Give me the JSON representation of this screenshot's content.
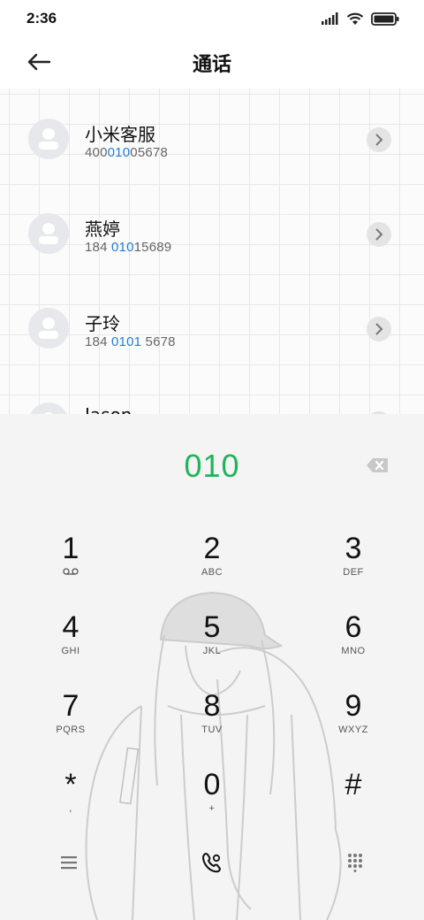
{
  "status_bar": {
    "time": "2:36",
    "icons": [
      "signal-icon",
      "wifi-icon",
      "battery-icon"
    ]
  },
  "header": {
    "title": "通话",
    "back_icon": "back-arrow-icon"
  },
  "contacts": [
    {
      "name": "小米客服",
      "number_pre": "400",
      "number_hl": "010",
      "number_post": "05678"
    },
    {
      "name": "燕婷",
      "number_pre": "184 ",
      "number_hl": "010",
      "number_post": "15689"
    },
    {
      "name": "子玲",
      "number_pre": "184 ",
      "number_hl": "0101",
      "number_post": " 5678"
    },
    {
      "name": "Jason",
      "number_pre": "",
      "number_hl": "",
      "number_post": ""
    }
  ],
  "dialer": {
    "input": "010",
    "accent_color": "#1fb45a",
    "keys": [
      {
        "digit": "1",
        "letters": ""
      },
      {
        "digit": "2",
        "letters": "ABC"
      },
      {
        "digit": "3",
        "letters": "DEF"
      },
      {
        "digit": "4",
        "letters": "GHI"
      },
      {
        "digit": "5",
        "letters": "JKL"
      },
      {
        "digit": "6",
        "letters": "MNO"
      },
      {
        "digit": "7",
        "letters": "PQRS"
      },
      {
        "digit": "8",
        "letters": "TUV"
      },
      {
        "digit": "9",
        "letters": "WXYZ"
      },
      {
        "digit": "*",
        "letters": ","
      },
      {
        "digit": "0",
        "letters": "+"
      },
      {
        "digit": "#",
        "letters": ""
      }
    ],
    "bottom_icons": [
      "menu-icon",
      "call-icon",
      "dialpad-icon"
    ]
  },
  "colors": {
    "highlight": "#1f7fd6",
    "dialer_bg": "#f4f4f4"
  }
}
